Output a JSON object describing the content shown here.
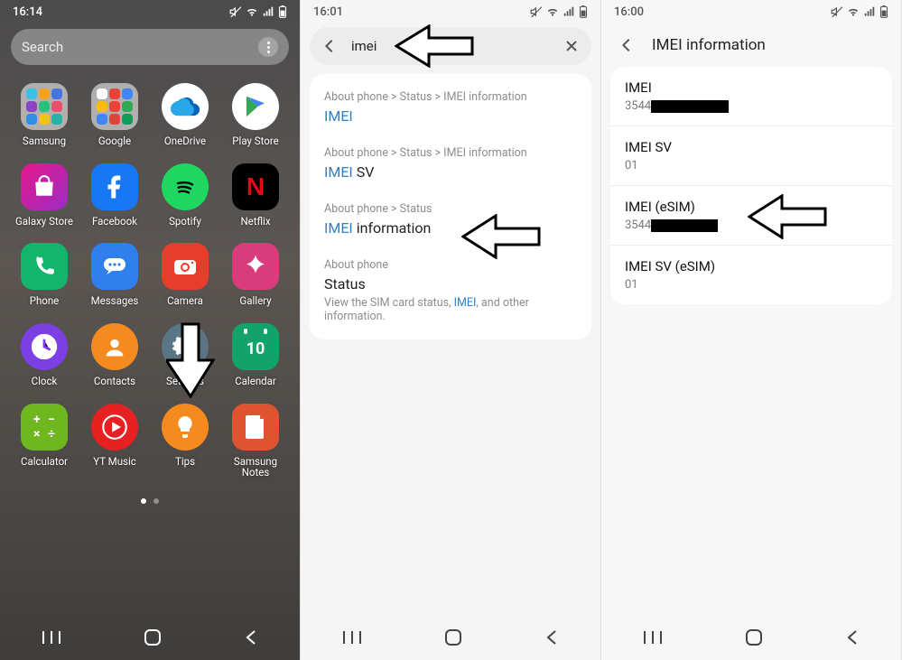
{
  "panel1": {
    "time": "16:14",
    "search_placeholder": "Search",
    "apps": [
      {
        "id": "samsung",
        "label": "Samsung"
      },
      {
        "id": "google",
        "label": "Google"
      },
      {
        "id": "onedrive",
        "label": "OneDrive"
      },
      {
        "id": "playstore",
        "label": "Play Store"
      },
      {
        "id": "galaxystore",
        "label": "Galaxy Store"
      },
      {
        "id": "facebook",
        "label": "Facebook"
      },
      {
        "id": "spotify",
        "label": "Spotify"
      },
      {
        "id": "netflix",
        "label": "Netflix"
      },
      {
        "id": "phone",
        "label": "Phone"
      },
      {
        "id": "messages",
        "label": "Messages"
      },
      {
        "id": "camera",
        "label": "Camera"
      },
      {
        "id": "gallery",
        "label": "Gallery"
      },
      {
        "id": "clock",
        "label": "Clock"
      },
      {
        "id": "contacts",
        "label": "Contacts"
      },
      {
        "id": "settings",
        "label": "Settings"
      },
      {
        "id": "calendar",
        "label": "Calendar"
      },
      {
        "id": "calculator",
        "label": "Calculator"
      },
      {
        "id": "ytmusic",
        "label": "YT Music"
      },
      {
        "id": "tips",
        "label": "Tips"
      },
      {
        "id": "samsungnotes",
        "label": "Samsung\nNotes"
      }
    ],
    "calendar_day": "10"
  },
  "panel2": {
    "time": "16:01",
    "query": "imei",
    "results": [
      {
        "crumb": "About phone > Status > IMEI information",
        "title_hl": "IMEI",
        "title_rest": ""
      },
      {
        "crumb": "About phone > Status > IMEI information",
        "title_hl": "IMEI",
        "title_rest": " SV"
      },
      {
        "crumb": "About phone > Status",
        "title_hl": "IMEI",
        "title_rest": " information"
      },
      {
        "crumb": "About phone",
        "title_hl": "",
        "title_rest": "Status",
        "desc_a": "View the SIM card status, ",
        "desc_hl": "IMEI",
        "desc_b": ", and other information."
      }
    ]
  },
  "panel3": {
    "time": "16:00",
    "title": "IMEI information",
    "rows": [
      {
        "k": "IMEI",
        "v_prefix": "3544",
        "redact_w": 86
      },
      {
        "k": "IMEI SV",
        "v_prefix": "01",
        "redact_w": 0
      },
      {
        "k": "IMEI (eSIM)",
        "v_prefix": "3544",
        "redact_w": 74
      },
      {
        "k": "IMEI SV (eSIM)",
        "v_prefix": "01",
        "redact_w": 0
      }
    ]
  }
}
